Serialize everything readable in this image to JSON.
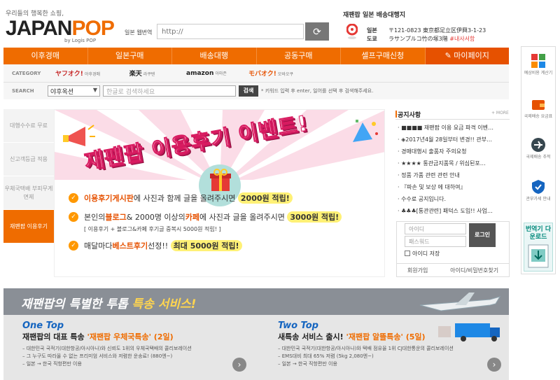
{
  "header": {
    "tagline": "우리들의 행복한 쇼핑,",
    "logo_main": "JAPAN",
    "logo_accent": "POP",
    "logo_sub": "by Logis POP",
    "url_label": "일본 웹번역",
    "url_placeholder": "http://",
    "address_title": "재팬팝 일본 배송대행지",
    "address_keys": [
      "일본",
      "도쿄"
    ],
    "address_lines": [
      "〒121-0823 東京都足立区伊興3-1-23",
      "ラサンプルコ竹の塚3階"
    ],
    "address_highlight": "#내사서함"
  },
  "nav": {
    "items": [
      "이후경매",
      "일본구매",
      "배송대행",
      "공동구매",
      "셀프구매신청"
    ],
    "mypage": "마이페이지"
  },
  "category": {
    "label": "CATEGORY",
    "items": [
      {
        "name": "ヤフオク!",
        "sub": "야후경매"
      },
      {
        "name": "楽天",
        "sub": "라쿠텐"
      },
      {
        "name": "amazon",
        "sub": "아마존"
      },
      {
        "name": "モバオク!",
        "sub": "모바오쿠"
      }
    ]
  },
  "search": {
    "label": "SEARCH",
    "select_value": "야후옥션",
    "placeholder": "한글로 검색하세요",
    "button": "검색",
    "hint": "* 키워드 입력 후 enter, 일어를 선택 후 검색해주세요."
  },
  "left_tabs": [
    "대행수수료 무료",
    "신고객등급 적용",
    "우체국택배 부피무게면제",
    "재팬팝 이용후기"
  ],
  "banner": {
    "title": "재팬팝 이용후기 이벤트!",
    "line1_pre": "이용후기게시판",
    "line1_mid": "에 사진과 함께 글을 올려주시면",
    "line1_hl": "2000원 적립!",
    "line2_a": "본인의 ",
    "line2_blog": "블로그",
    "line2_b": " & 2000명 이상의 ",
    "line2_cafe": "카페",
    "line2_c": "에 사진과 글을 올려주시면",
    "line2_hl": "3000원 적립!",
    "line2_sub": "[ 이용후기 + 블로그&카페 후기글 중복시 5000원 적립! ]",
    "line3_a": "매달마다 ",
    "line3_best": "베스트후기",
    "line3_b": " 선정!!",
    "line3_hl": "최대 5000원 적립!"
  },
  "notice": {
    "title": "공지사항",
    "more": "+ MORE",
    "items": [
      "■■■■ 재팬팝 이용 요금 파격 이벤…",
      "◈2017년4월 28일부터 변경!! 관부…",
      "경매대행시 출품자 주의요청",
      "★★★★ 통관금지품목 / 위심된포…",
      "정품 가품 관련 관련 안내",
      "『파손 및 보상 에 대하여』",
      "수수료 공지입니다.",
      "♣♣♣[통관관련] 패덕스 도입!! 사업…"
    ]
  },
  "login": {
    "id_placeholder": "아이디",
    "pw_placeholder": "패스워드",
    "button": "로그인",
    "save": "아이디 저장",
    "join": "회원가입",
    "find": "아이디/비밀번호찾기"
  },
  "quick_menu": {
    "items": [
      "예상비용 계산기",
      "국제배송 요금표",
      "국제배송 추적",
      "관부가세 안내"
    ],
    "download": "번역기 다운로드"
  },
  "service": {
    "title_a": "재팬팝의 특별한 투톱 ",
    "title_b": "특송 서비스!",
    "left": {
      "brand": "One Top",
      "heading_a": "재팬팝의 대표 특송 ",
      "heading_b": "'재팬팝 우체국특송' (2일)",
      "lines": [
        "– 대한민국 국적기(대한항공/아시아나)와 신뢰도 1위의 우체국택배의 콜리보레이션",
        "– 그 누구도 따라올 수 없는 프리미엄 서비스와 저렴한 운송료! (880엔~)",
        "– 일본 → 한국 직항편만 이용"
      ]
    },
    "right": {
      "brand": "Two Top",
      "heading_a": "새특송 서비스 출시! ",
      "heading_b": "'재팬팝 알뜰특송' (5일)",
      "lines": [
        "– 대한민국 국적기(대한항공/아시아나)와 택배 점유율 1위 CJ대한통운의 콜리보레이션",
        "– EMS대비 최대 65% 저렴 (5kg 2,080엔~)",
        "– 일본 → 한국 직항편만 이용"
      ]
    }
  },
  "colors": {
    "brand": "#ef6c00",
    "accent_red": "#e53935"
  }
}
